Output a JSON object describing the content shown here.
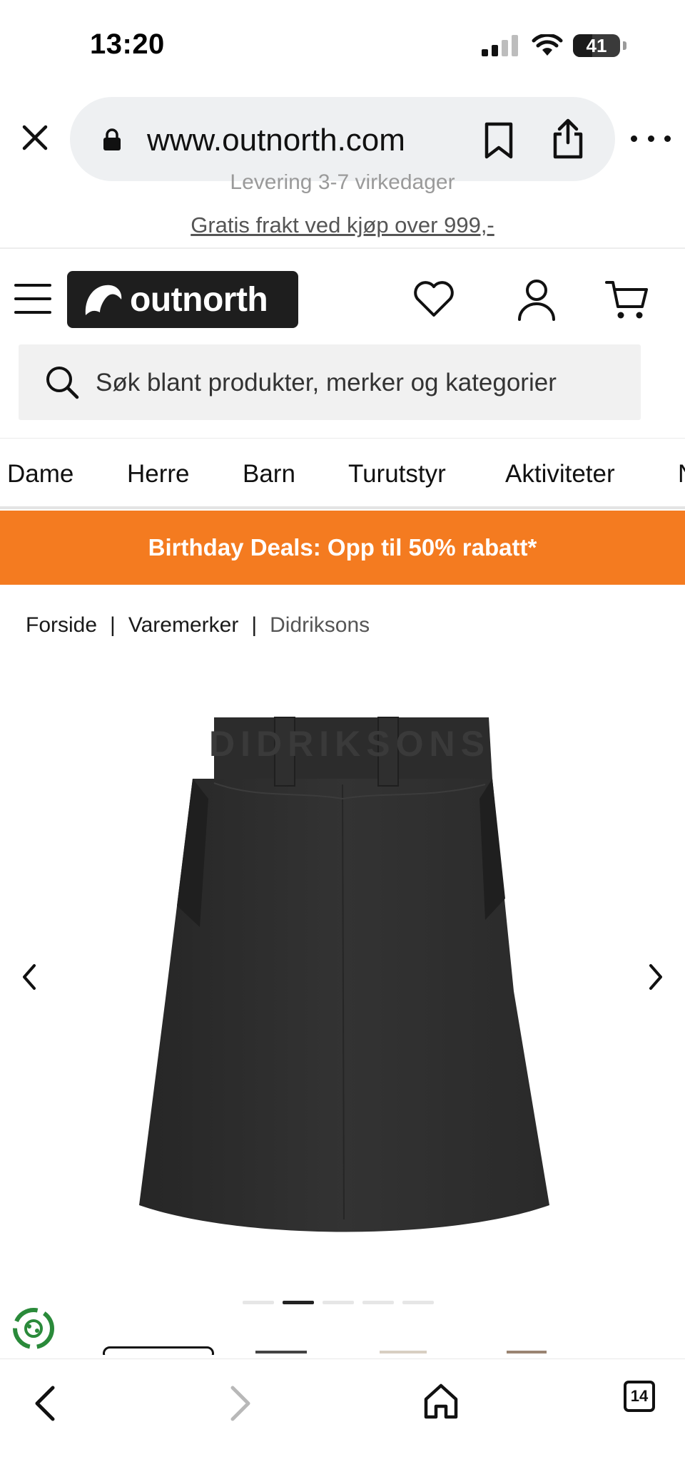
{
  "status_bar": {
    "time": "13:20",
    "battery": "41",
    "battery_level": 0.41
  },
  "browser": {
    "url": "www.outnorth.com",
    "tab_count": "14"
  },
  "site": {
    "delivery_note": "Levering 3-7 virkedager",
    "shipping_note": "Gratis frakt ved kjøp over 999,-",
    "logo_text": "outnorth",
    "search_placeholder": "Søk blant produkter, merker og kategorier"
  },
  "categories": [
    {
      "label": "Dame"
    },
    {
      "label": "Herre"
    },
    {
      "label": "Barn"
    },
    {
      "label": "Turutstyr"
    },
    {
      "label": "Aktiviteter"
    },
    {
      "label": "N"
    }
  ],
  "promo": {
    "text": "Birthday Deals: Opp til 50% rabatt*",
    "color": "#f47b20"
  },
  "breadcrumb": [
    {
      "label": "Forside"
    },
    {
      "label": "Varemerker"
    },
    {
      "label": "Didriksons"
    }
  ],
  "breadcrumb_separator": "|",
  "product": {
    "image_icon": "skirt-product-image",
    "waistband_text": "DIDRIKSONS",
    "gallery_count": 5,
    "gallery_active_index": 2
  },
  "icons": {
    "close": "close-icon",
    "lock": "lock-icon",
    "bookmark": "bookmark-icon",
    "share": "share-icon",
    "more": "more-icon",
    "menu": "hamburger-icon",
    "wishlist": "heart-icon",
    "account": "user-icon",
    "cart": "cart-icon",
    "search": "search-icon",
    "prev": "chevron-left-icon",
    "next": "chevron-right-icon",
    "back": "back-icon",
    "forward": "forward-icon",
    "home": "home-icon"
  }
}
